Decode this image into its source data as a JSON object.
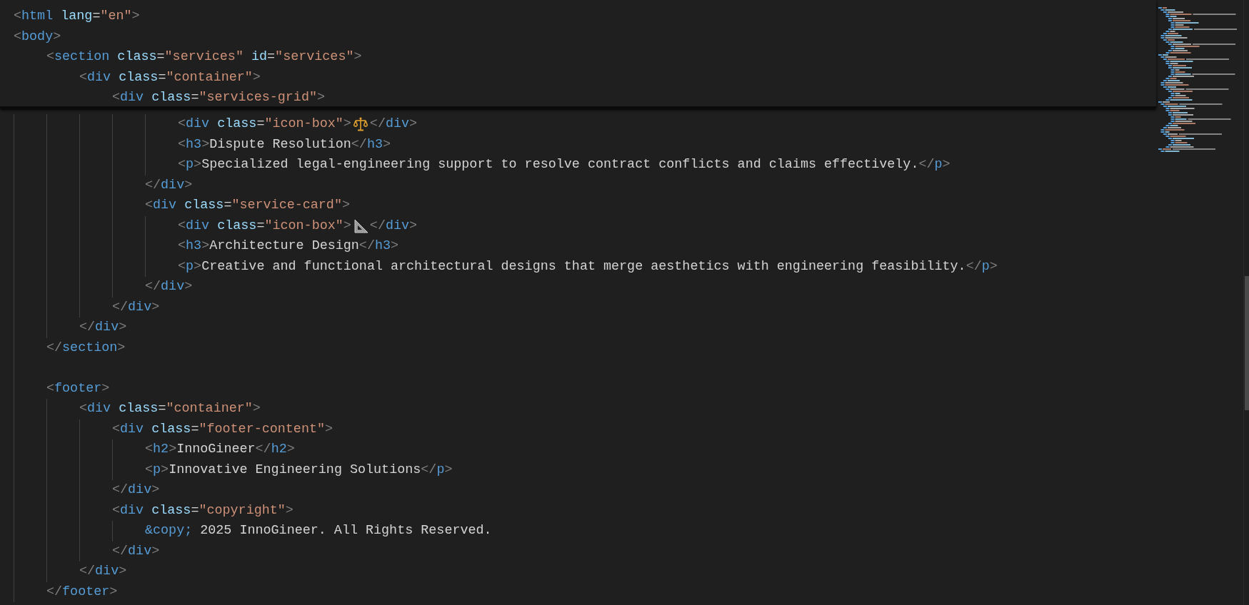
{
  "sticky_scroll": [
    {
      "kind": "code",
      "code": "<html lang=\"en\">"
    },
    {
      "kind": "code",
      "code": "<body>",
      "children": [
        {
          "kind": "code",
          "code": "<section class=\"services\" id=\"services\">",
          "children": [
            {
              "kind": "code",
              "code": "<div class=\"container\">",
              "children": [
                {
                  "kind": "code",
                  "code": "<div class=\"services-grid\">"
                }
              ]
            }
          ]
        }
      ]
    }
  ],
  "lines": [
    {
      "children": [
        {
          "children": [
            {
              "children": [
                {
                  "children": [
                    {
                      "children": [
                        {
                          "kind": "scales",
                          "code": "<div class=\"icon-box\">",
                          "code_after": "</div>"
                        },
                        {
                          "kind": "code",
                          "code": "<h3>Dispute Resolution</h3>"
                        },
                        {
                          "kind": "code",
                          "code": "<p>Specialized legal-engineering support to resolve contract conflicts and claims effectively.</p>"
                        }
                      ]
                    },
                    {
                      "kind": "code",
                      "code": "</div>"
                    },
                    {
                      "kind": "code",
                      "code": "<div class=\"service-card\">",
                      "children": [
                        {
                          "kind": "setsquare",
                          "code": "<div class=\"icon-box\">",
                          "code_after": "</div>"
                        },
                        {
                          "kind": "code",
                          "code": "<h3>Architecture Design</h3>"
                        },
                        {
                          "kind": "code",
                          "code": "<p>Creative and functional architectural designs that merge aesthetics with engineering feasibility.</p>"
                        }
                      ]
                    },
                    {
                      "kind": "code",
                      "code": "</div>"
                    }
                  ]
                },
                {
                  "kind": "code",
                  "code": "</div>"
                }
              ]
            },
            {
              "kind": "code",
              "code": "</div>"
            }
          ]
        },
        {
          "kind": "code",
          "code": "</section>"
        },
        {
          "kind": "blank"
        },
        {
          "kind": "code",
          "code": "<footer>",
          "children": [
            {
              "kind": "code",
              "code": "<div class=\"container\">",
              "children": [
                {
                  "kind": "code",
                  "code": "<div class=\"footer-content\">",
                  "children": [
                    {
                      "kind": "code",
                      "code": "<h2>InnoGineer</h2>"
                    },
                    {
                      "kind": "code",
                      "code": "<p>Innovative Engineering Solutions</p>"
                    }
                  ]
                },
                {
                  "kind": "code",
                  "code": "</div>"
                },
                {
                  "kind": "code",
                  "code": "<div class=\"copyright\">",
                  "children": [
                    {
                      "kind": "code",
                      "code": "&copy; 2025 InnoGineer. All Rights Reserved."
                    }
                  ]
                },
                {
                  "kind": "code",
                  "code": "</div>"
                }
              ]
            },
            {
              "kind": "code",
              "code": "</div>"
            }
          ]
        },
        {
          "kind": "code",
          "code": "</footer>"
        }
      ]
    }
  ]
}
